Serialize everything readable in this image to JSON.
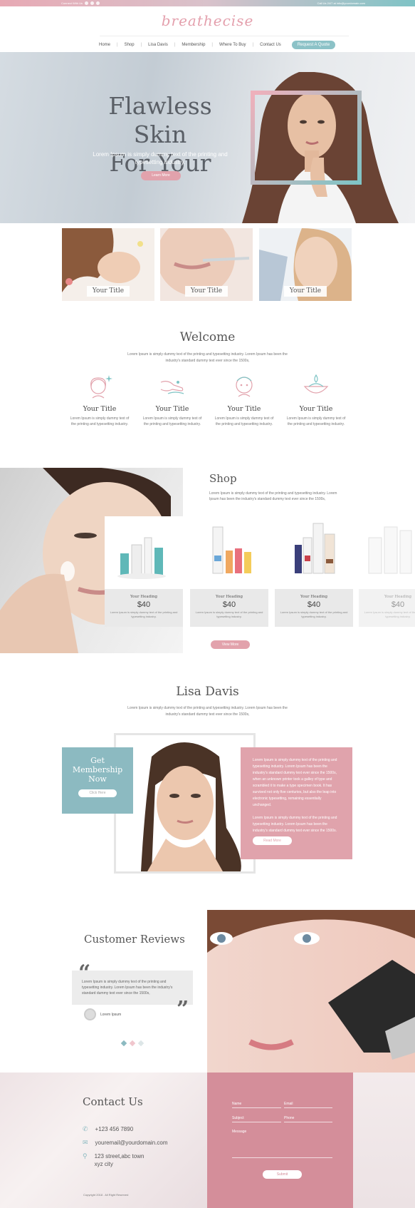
{
  "topbar": {
    "connect": "Connect With Us",
    "call": "Call Us 24/7 at",
    "email": "info@yourdomain.com"
  },
  "logo": "breathecise",
  "nav": {
    "items": [
      "Home",
      "Shop",
      "Lisa Davis",
      "Membership",
      "Where To Buy",
      "Contact Us"
    ],
    "quote_button": "Request A Quote"
  },
  "hero": {
    "title_line1": "Flawless Skin",
    "title_line2": "For Your",
    "subtitle": "Lorem Ipsum is simply dummy text of the printing and typesetting industry.",
    "button": "Learn More"
  },
  "tiles": [
    {
      "caption": "Your Title"
    },
    {
      "caption": "Your Title"
    },
    {
      "caption": "Your Title"
    }
  ],
  "welcome": {
    "title": "Welcome",
    "text": "Lorem Ipsum is simply dummy text of the printing and typesetting industry. Lorem Ipsum has been the industry's standard dummy text ever since the 1500s,",
    "features": [
      {
        "icon": "face-sparkle-icon",
        "title": "Your Title",
        "text": "Lorem Ipsum is simply dummy text of the printing and typesetting industry."
      },
      {
        "icon": "hand-cream-icon",
        "title": "Your Title",
        "text": "Lorem Ipsum is simply dummy text of the printing and typesetting industry."
      },
      {
        "icon": "face-mask-icon",
        "title": "Your Title",
        "text": "Lorem Ipsum is simply dummy text of the printing and typesetting industry."
      },
      {
        "icon": "cream-bowl-icon",
        "title": "Your Title",
        "text": "Lorem Ipsum is simply dummy text of the printing and typesetting industry."
      }
    ]
  },
  "shop": {
    "title": "Shop",
    "text": "Lorem Ipsum is simply dummy text of the printing and typesetting industry. Lorem Ipsum has been the industry's standard dummy text ever since the 1500s,",
    "products": [
      {
        "heading": "Your Heading",
        "price": "$40",
        "text": "Lorem Ipsum is simply dummy text of the printing and typesetting industry."
      },
      {
        "heading": "Your Heading",
        "price": "$40",
        "text": "Lorem Ipsum is simply dummy text of the printing and typesetting industry."
      },
      {
        "heading": "Your Heading",
        "price": "$40",
        "text": "Lorem Ipsum is simply dummy text of the printing and typesetting industry."
      },
      {
        "heading": "Your Heading",
        "price": "$40",
        "text": "Lorem Ipsum is simply dummy text of the printing and typesetting industry."
      }
    ],
    "button": "View More"
  },
  "lisa": {
    "title": "Lisa Davis",
    "text": "Lorem Ipsum is simply dummy text of the printing and typesetting industry. Lorem Ipsum has been the industry's standard dummy text ever since the 1500s,",
    "membership_line1": "Get",
    "membership_line2": "Membership",
    "membership_line3": "Now",
    "membership_button": "Click Here",
    "para1": "Lorem Ipsum is simply dummy text of the printing and typesetting industry. Lorem Ipsum has been the industry's standard dummy text ever since the 1500s, when an unknown printer took a galley of type and scrambled it to make a type specimen book. It has survived not only five centuries, but also the leap into electronic typesetting, remaining essentially unchanged.",
    "para2": "Lorem Ipsum is simply dummy text of the printing and typesetting industry. Lorem Ipsum has been the industry's standard dummy text ever since the 1500s.",
    "read_more": "Read More"
  },
  "reviews": {
    "title": "Customer Reviews",
    "quote": "Lorem Ipsum is simply dummy text of the printing and typesetting industry. Lorem Ipsum has been the industry's standard dummy text ever since the 1500s,",
    "user": "Lorem Ipsum"
  },
  "contact": {
    "title": "Contact Us",
    "phone": "+123 456 7890",
    "email": "youremail@yourdomain.com",
    "address_line1": "123 street,abc town",
    "address_line2": "xyz city",
    "copyright": "Copyright 2018 . All Right Reserved",
    "form": {
      "name": "Name",
      "email": "Email",
      "subject": "Subject",
      "phone": "Phone",
      "message": "Message",
      "submit": "Submit"
    }
  },
  "colors": {
    "pink": "#e2a2ac",
    "teal": "#8cc2c7",
    "text": "#555555"
  }
}
